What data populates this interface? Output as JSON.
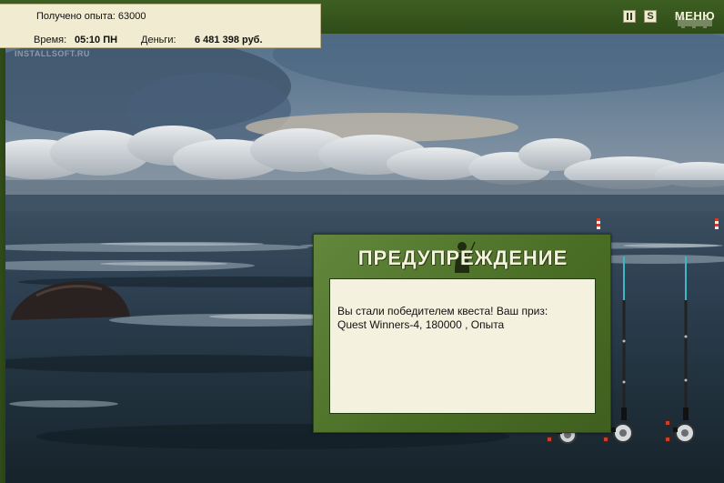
{
  "hud": {
    "experience_text": "Получено опыта: 63000",
    "time_label": "Время:",
    "time_value": "05:10 ПН",
    "money_label": "Деньги:",
    "money_value": "6 481 398 руб."
  },
  "controls": {
    "pause_icon": "pause-icon",
    "sound_label": "S",
    "menu_label": "МЕНЮ"
  },
  "watermark": "INSTALLSOFT.RU",
  "dialog": {
    "title": "ПРЕДУПРЕЖДЕНИЕ",
    "message_line1": "Вы стали победителем квеста! Ваш приз:",
    "message_line2": "Quest Winners-4, 180000 , Опыта"
  },
  "colors": {
    "hud_green": "#3d5f22",
    "panel_cream": "#f1ecd1",
    "dialog_green": "#4a6e25",
    "bobber_red": "#d63b22",
    "rod_orange": "#d98a28"
  },
  "rods": {
    "count_visible": 3
  }
}
